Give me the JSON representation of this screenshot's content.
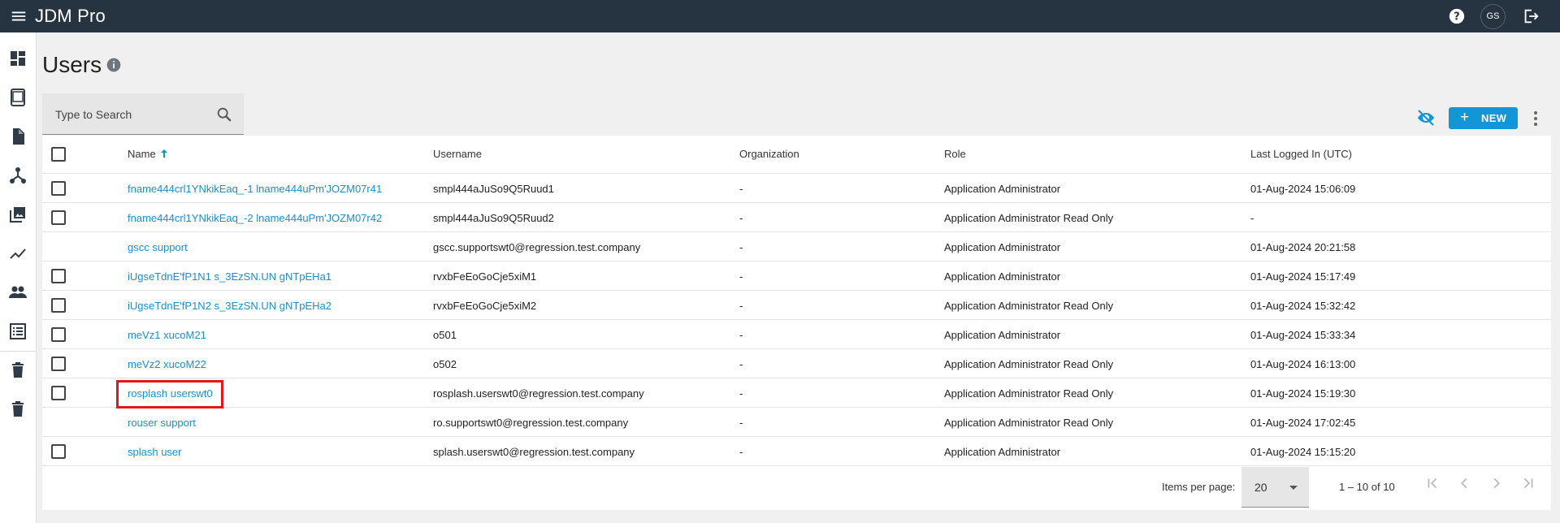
{
  "app": {
    "title": "JDM Pro",
    "user_initials": "GS"
  },
  "topbar": {
    "menu_icon": "menu-icon",
    "help_icon": "help-icon",
    "logout_icon": "logout-icon"
  },
  "sidebar": {
    "items": [
      {
        "name": "dashboard",
        "icon": "dashboard-icon"
      },
      {
        "name": "devices",
        "icon": "tablet-icon"
      },
      {
        "name": "documents",
        "icon": "document-icon"
      },
      {
        "name": "hierarchy",
        "icon": "hierarchy-icon"
      },
      {
        "name": "media",
        "icon": "image-library-icon"
      },
      {
        "name": "analytics",
        "icon": "trend-icon"
      },
      {
        "name": "users",
        "icon": "people-icon"
      },
      {
        "name": "reports",
        "icon": "list-icon"
      },
      {
        "name": "trash-1",
        "icon": "trash-icon"
      },
      {
        "name": "trash-2",
        "icon": "trash-icon"
      }
    ]
  },
  "page": {
    "title": "Users",
    "info_icon": "info-icon"
  },
  "search": {
    "placeholder": "Type to Search"
  },
  "toolbar": {
    "new_label": "NEW",
    "visibility_icon": "visibility-off-icon",
    "more_icon": "more-vert-icon"
  },
  "table": {
    "columns": {
      "name": "Name",
      "username": "Username",
      "organization": "Organization",
      "role": "Role",
      "last_logged_in": "Last Logged In (UTC)"
    },
    "sort": {
      "column": "name",
      "direction": "ascending"
    },
    "rows": [
      {
        "name": "fname444crl1YNkikEaq_-1 lname444uPm'JOZM07r41",
        "username": "smpl444aJuSo9Q5Ruud1",
        "organization": "-",
        "role": "Application Administrator",
        "last": "01-Aug-2024 15:06:09",
        "checkbox": true
      },
      {
        "name": "fname444crl1YNkikEaq_-2 lname444uPm'JOZM07r42",
        "username": "smpl444aJuSo9Q5Ruud2",
        "organization": "-",
        "role": "Application Administrator Read Only",
        "last": "-",
        "checkbox": true
      },
      {
        "name": "gscc support",
        "username": "gscc.supportswt0@regression.test.company",
        "organization": "-",
        "role": "Application Administrator",
        "last": "01-Aug-2024 20:21:58",
        "checkbox": false
      },
      {
        "name": "iUgseTdnE'fP1N1 s_3EzSN.UN gNTpEHa1",
        "username": "rvxbFeEoGoCje5xiM1",
        "organization": "-",
        "role": "Application Administrator",
        "last": "01-Aug-2024 15:17:49",
        "checkbox": true
      },
      {
        "name": "iUgseTdnE'fP1N2 s_3EzSN.UN gNTpEHa2",
        "username": "rvxbFeEoGoCje5xiM2",
        "organization": "-",
        "role": "Application Administrator Read Only",
        "last": "01-Aug-2024 15:32:42",
        "checkbox": true
      },
      {
        "name": "meVz1 xucoM21",
        "username": "o501",
        "organization": "-",
        "role": "Application Administrator",
        "last": "01-Aug-2024 15:33:34",
        "checkbox": true
      },
      {
        "name": "meVz2 xucoM22",
        "username": "o502",
        "organization": "-",
        "role": "Application Administrator Read Only",
        "last": "01-Aug-2024 16:13:00",
        "checkbox": true
      },
      {
        "name": "rosplash userswt0",
        "username": "rosplash.userswt0@regression.test.company",
        "organization": "-",
        "role": "Application Administrator Read Only",
        "last": "01-Aug-2024 15:19:30",
        "checkbox": true,
        "highlighted": true
      },
      {
        "name": "rouser support",
        "username": "ro.supportswt0@regression.test.company",
        "organization": "-",
        "role": "Application Administrator Read Only",
        "last": "01-Aug-2024 17:02:45",
        "checkbox": false
      },
      {
        "name": "splash user",
        "username": "splash.userswt0@regression.test.company",
        "organization": "-",
        "role": "Application Administrator",
        "last": "01-Aug-2024 15:15:20",
        "checkbox": true
      }
    ]
  },
  "paginator": {
    "items_per_page_label": "Items per page:",
    "items_per_page": "20",
    "range": "1 – 10 of 10"
  },
  "colors": {
    "topbar": "#263340",
    "accent": "#1396d6",
    "link": "#1a8fd0",
    "highlight": "#e0181b"
  }
}
